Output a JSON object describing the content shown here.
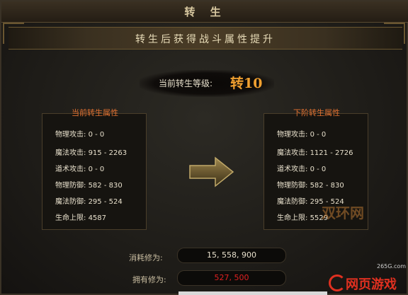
{
  "window": {
    "title": "转 生"
  },
  "banner": {
    "text": "转生后获得战斗属性提升"
  },
  "level": {
    "label": "当前转生等级:",
    "value": "转10"
  },
  "current_panel": {
    "header": "当前转生属性",
    "stats": [
      {
        "name": "物理攻击:",
        "value": "0 - 0"
      },
      {
        "name": "魔法攻击:",
        "value": "915 - 2263"
      },
      {
        "name": "道术攻击:",
        "value": "0 - 0"
      },
      {
        "name": "物理防御:",
        "value": "582 - 830"
      },
      {
        "name": "魔法防御:",
        "value": "295 - 524"
      },
      {
        "name": "生命上限:",
        "value": "4587"
      }
    ]
  },
  "next_panel": {
    "header": "下阶转生属性",
    "stats": [
      {
        "name": "物理攻击:",
        "value": "0 - 0"
      },
      {
        "name": "魔法攻击:",
        "value": "1121 - 2726"
      },
      {
        "name": "道术攻击:",
        "value": "0 - 0"
      },
      {
        "name": "物理防御:",
        "value": "582 - 830"
      },
      {
        "name": "魔法防御:",
        "value": "295 - 524"
      },
      {
        "name": "生命上限:",
        "value": "5529"
      }
    ]
  },
  "cost": {
    "label": "消耗修为:",
    "value": "15, 558, 900"
  },
  "owned": {
    "label": "拥有修为:",
    "value": "527, 500"
  },
  "watermark": {
    "mid_text": "双环网",
    "site_small": "265G.com",
    "logo_text": "网页游戏"
  },
  "colors": {
    "accent_orange": "#f0a030",
    "header_orange": "#e07030",
    "owned_red": "#e02020",
    "frame_gold": "#6a5630"
  }
}
